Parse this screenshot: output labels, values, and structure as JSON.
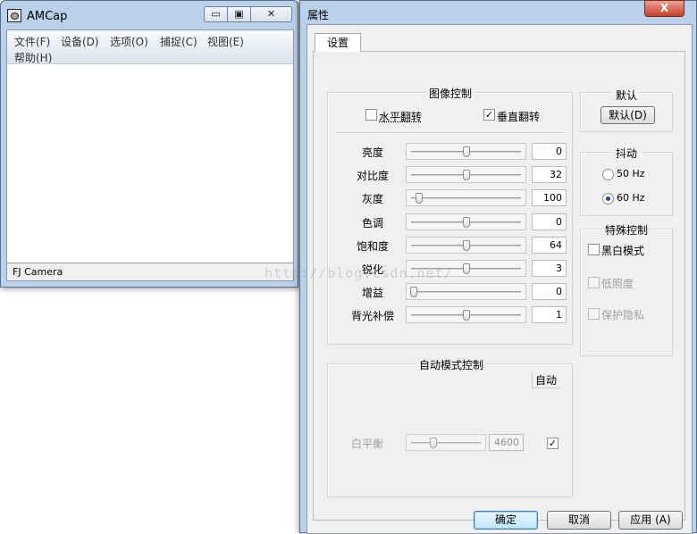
{
  "amcap": {
    "title": "AMCap",
    "menu": [
      "文件(F)",
      "设备(D)",
      "选项(O)",
      "捕捉(C)",
      "视图(E)",
      "帮助(H)"
    ],
    "status": "FJ Camera",
    "controls": {
      "minimize": "▭",
      "maximize": "▣",
      "close": "✕"
    }
  },
  "dialog": {
    "title": "属性",
    "close": "X",
    "tab": "设置",
    "image_control": {
      "title": "图像控制",
      "hflip": {
        "label": "水平翻转",
        "checked": false
      },
      "vflip": {
        "label": "垂直翻转",
        "checked": true
      },
      "sliders": [
        {
          "label": "亮度",
          "value": "0",
          "level": 0.5
        },
        {
          "label": "对比度",
          "value": "32",
          "level": 0.5
        },
        {
          "label": "灰度",
          "value": "100",
          "level": 0.05
        },
        {
          "label": "色调",
          "value": "0",
          "level": 0.5
        },
        {
          "label": "饱和度",
          "value": "64",
          "level": 0.5
        },
        {
          "label": "锐化",
          "value": "3",
          "level": 0.5
        },
        {
          "label": "增益",
          "value": "0",
          "level": 0.0
        },
        {
          "label": "背光补偿",
          "value": "1",
          "level": 0.5
        }
      ]
    },
    "default_group": {
      "title": "默认",
      "button": "默认(D)"
    },
    "flicker": {
      "title": "抖动",
      "options": [
        "50 Hz",
        "60 Hz"
      ],
      "selected": "60 Hz"
    },
    "special": {
      "title": "特殊控制",
      "items": [
        {
          "label": "黑白模式",
          "enabled": true
        },
        {
          "label": "低照度",
          "enabled": false
        },
        {
          "label": "保护隐私",
          "enabled": false
        }
      ]
    },
    "auto_mode": {
      "title": "自动模式控制",
      "auto_label": "自动",
      "white_balance": {
        "label": "白平衡",
        "value": "4600",
        "level": 0.3,
        "auto_checked": true
      }
    },
    "buttons": {
      "ok": "确定",
      "cancel": "取消",
      "apply": "应用 (A)"
    }
  },
  "watermark": "http://blog.csdn.net/"
}
